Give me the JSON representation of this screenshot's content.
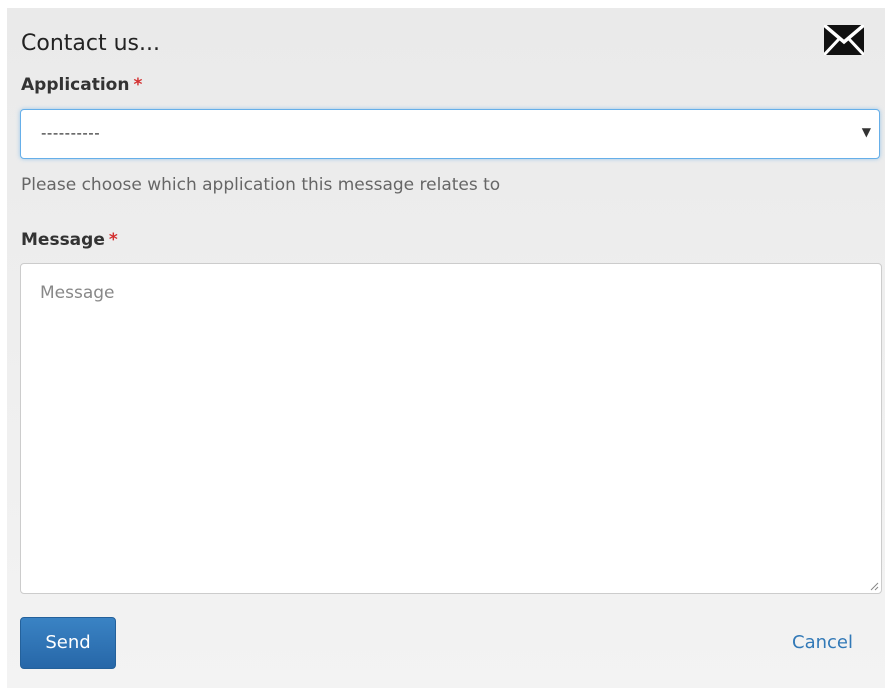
{
  "dialog": {
    "title": "Contact us...",
    "icon": "envelope-icon"
  },
  "application": {
    "label": "Application",
    "required_marker": "*",
    "selected_value": "----------",
    "help_text": "Please choose which application this message relates to"
  },
  "message": {
    "label": "Message",
    "required_marker": "*",
    "placeholder": "Message"
  },
  "actions": {
    "send_label": "Send",
    "cancel_label": "Cancel"
  },
  "colors": {
    "accent": "#2d72b5",
    "link": "#3279b7",
    "required": "#d32f2f",
    "focus_border": "#66afe9"
  }
}
